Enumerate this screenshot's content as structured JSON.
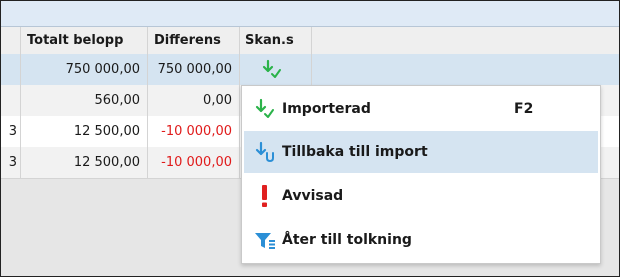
{
  "table": {
    "columns": [
      "",
      "Totalt belopp",
      "Differens",
      "Skan.s"
    ],
    "rows": [
      {
        "id": "",
        "total": "750 000,00",
        "diff": "750 000,00",
        "diff_negative": false,
        "status_icon": "imported-check-icon"
      },
      {
        "id": "",
        "total": "560,00",
        "diff": "0,00",
        "diff_negative": false,
        "status_icon": ""
      },
      {
        "id": "3",
        "total": "12 500,00",
        "diff": "-10 000,00",
        "diff_negative": true,
        "status_icon": ""
      },
      {
        "id": "3",
        "total": "12 500,00",
        "diff": "-10 000,00",
        "diff_negative": true,
        "status_icon": ""
      }
    ]
  },
  "menu": {
    "items": [
      {
        "label": "Importerad",
        "shortcut": "F2",
        "icon": "imported-check-icon",
        "selected": false
      },
      {
        "label": "Tillbaka till import",
        "shortcut": "",
        "icon": "back-to-import-icon",
        "selected": true
      },
      {
        "label": "Avvisad",
        "shortcut": "",
        "icon": "exclamation-icon",
        "selected": false
      },
      {
        "label": "Åter till tolkning",
        "shortcut": "",
        "icon": "filter-icon",
        "selected": false
      }
    ]
  },
  "colors": {
    "selection": "#d5e4f1",
    "negative": "#e01b1b",
    "check_green": "#2bb34a",
    "arrow_blue": "#2b8fd6",
    "alert_red": "#e02020"
  }
}
